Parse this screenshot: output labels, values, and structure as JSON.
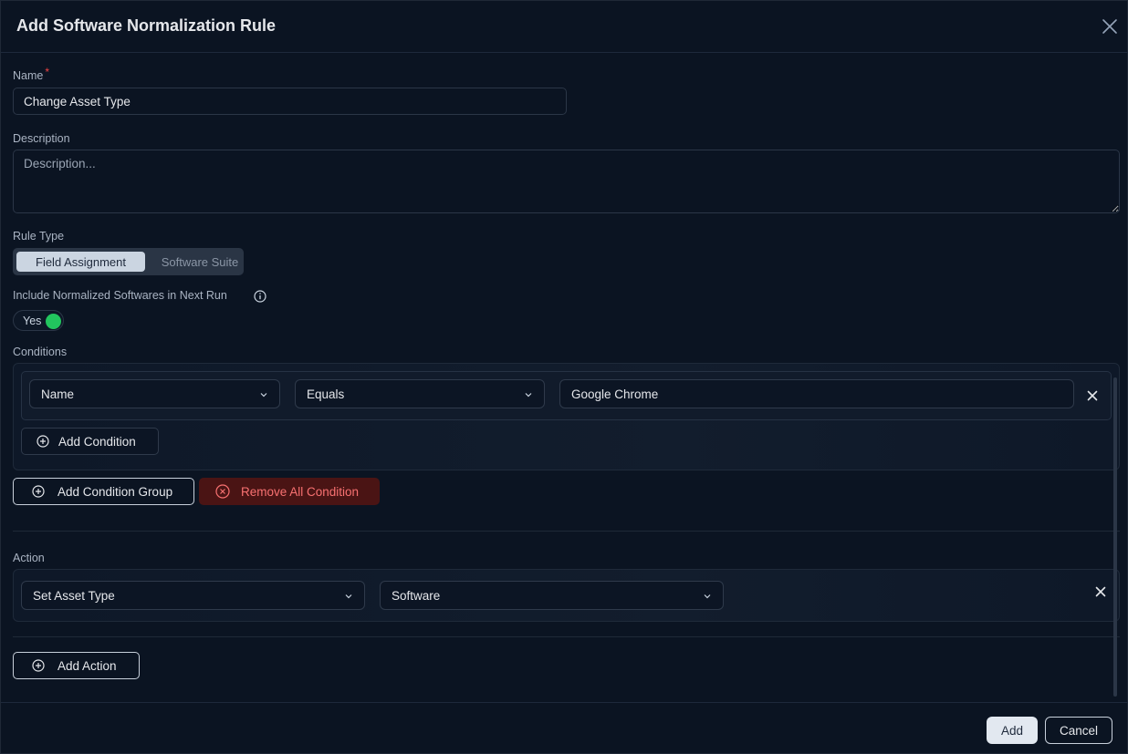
{
  "dialog": {
    "title": "Add Software Normalization Rule"
  },
  "name_field": {
    "label": "Name",
    "required_mark": "*",
    "value": "Change Asset Type"
  },
  "description_field": {
    "label": "Description",
    "placeholder": "Description..."
  },
  "rule_type": {
    "label": "Rule Type",
    "options": [
      "Field Assignment",
      "Software Suite"
    ],
    "selected": "Field Assignment"
  },
  "include_normalized": {
    "label": "Include Normalized Softwares in Next Run",
    "info_icon": "info-icon",
    "toggle_label": "Yes",
    "toggle_on": true,
    "toggle_color": "#22c55e"
  },
  "conditions": {
    "label": "Conditions",
    "rows": [
      {
        "field": "Name",
        "operator": "Equals",
        "value": "Google Chrome"
      }
    ],
    "add_condition_label": "Add Condition",
    "add_group_label": "Add Condition Group",
    "remove_all_label": "Remove All Condition"
  },
  "action": {
    "label": "Action",
    "rows": [
      {
        "type": "Set Asset Type",
        "value": "Software"
      }
    ],
    "add_action_label": "Add Action"
  },
  "footer": {
    "add_label": "Add",
    "cancel_label": "Cancel"
  },
  "colors": {
    "background": "#0b1422",
    "danger_bg": "#4a1414",
    "danger_text": "#f87171",
    "required": "#ef4444"
  }
}
